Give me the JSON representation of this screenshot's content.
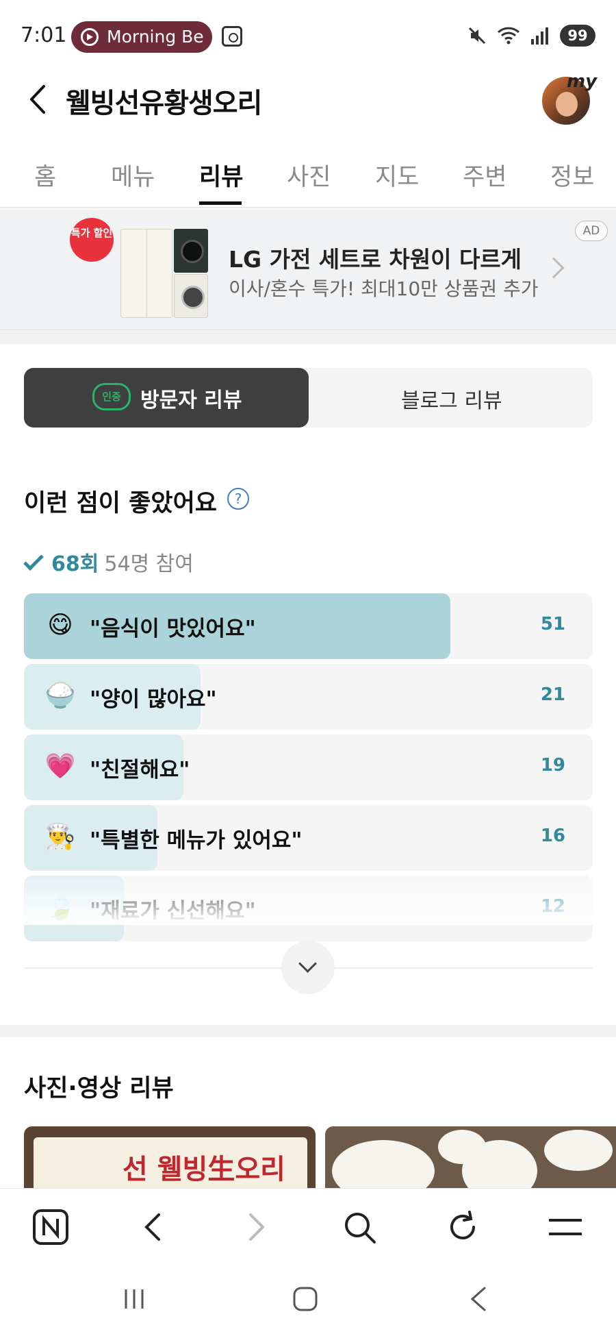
{
  "status_bar": {
    "time": "7:01",
    "media_pill": "Morning Be",
    "battery": "99"
  },
  "header": {
    "title": "웰빙선유황생오리",
    "avatar_badge": "my"
  },
  "tabs": [
    {
      "label": "홈"
    },
    {
      "label": "메뉴"
    },
    {
      "label": "리뷰"
    },
    {
      "label": "사진"
    },
    {
      "label": "지도"
    },
    {
      "label": "주변"
    },
    {
      "label": "정보"
    }
  ],
  "active_tab": "리뷰",
  "ad": {
    "badge": "특가 할인",
    "title": "LG 가전 세트로 차원이 다르게",
    "subtitle": "이사/혼수 특가! 최대10만 상품권 추가",
    "tag": "AD"
  },
  "review_toggle": {
    "cert_badge": "인증",
    "visitor": "방문자 리뷰",
    "blog": "블로그 리뷰"
  },
  "good_points": {
    "heading": "이런 점이 좋았어요",
    "help": "?",
    "count": "68회",
    "participants": "54명 참여",
    "items": [
      {
        "icon": "smiling-face-icon",
        "label": "\"음식이 맛있어요\"",
        "count": "51",
        "ratio": 0.75
      },
      {
        "icon": "rice-bowl-icon",
        "label": "\"양이 많아요\"",
        "count": "21",
        "ratio": 0.31
      },
      {
        "icon": "heart-face-icon",
        "label": "\"친절해요\"",
        "count": "19",
        "ratio": 0.28
      },
      {
        "icon": "chef-icon",
        "label": "\"특별한 메뉴가 있어요\"",
        "count": "16",
        "ratio": 0.235
      },
      {
        "icon": "leaf-icon",
        "label": "\"재료가 신선해요\"",
        "count": "12",
        "ratio": 0.176
      }
    ]
  },
  "photo_reviews": {
    "heading": "사진·영상 리뷰",
    "sign_text": "선 웰빙生오리"
  },
  "colors": {
    "accent": "#2f8a9e",
    "bar_strong": "#aad4d9",
    "bar_light": "#dcedf0",
    "segment_on": "#3f3f3f",
    "cert_green": "#28b46d",
    "ad_badge": "#e8323c"
  }
}
